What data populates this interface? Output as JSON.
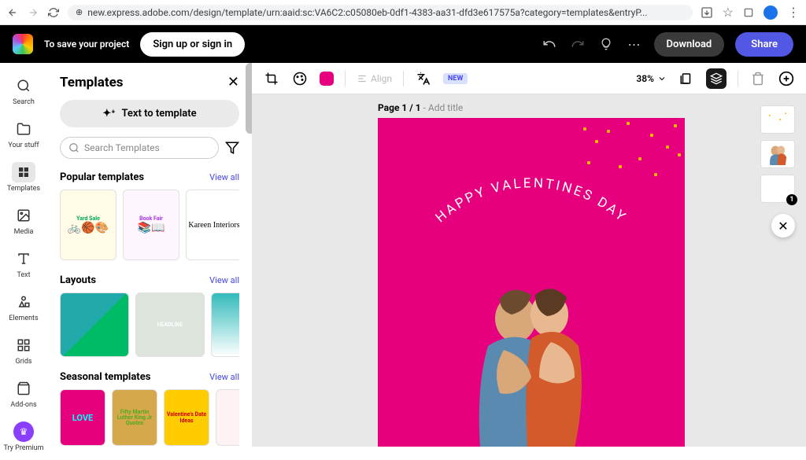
{
  "browser": {
    "url": "new.express.adobe.com/design/template/urn:aaid:sc:VA6C2:c05080eb-0df1-4383-aa31-dfd3e617575a?category=templates&entryP..."
  },
  "header": {
    "save_text": "To save your project",
    "signup_label": "Sign up or sign in",
    "download_label": "Download",
    "share_label": "Share"
  },
  "rail": {
    "search": "Search",
    "your_stuff": "Your stuff",
    "templates": "Templates",
    "media": "Media",
    "text": "Text",
    "elements": "Elements",
    "grids": "Grids",
    "addons": "Add-ons",
    "premium": "Try Premium"
  },
  "panel": {
    "title": "Templates",
    "text_to_template": "Text to template",
    "search_placeholder": "Search Templates",
    "popular": {
      "title": "Popular templates",
      "view_all": "View all",
      "items": [
        "Yard Sale",
        "Book Fair",
        "Kareen Interiors"
      ]
    },
    "layouts": {
      "title": "Layouts",
      "view_all": "View all",
      "items": [
        "",
        "HEADLINE",
        ""
      ]
    },
    "seasonal": {
      "title": "Seasonal templates",
      "view_all": "View all",
      "items": [
        "LOVE",
        "Fifty Martin Luther King Jr Quotes",
        "Valentine's Date Ideas",
        ""
      ]
    }
  },
  "toolbar": {
    "align_label": "Align",
    "new_badge": "NEW",
    "zoom": "38%"
  },
  "canvas": {
    "page_prefix": "Page 1 / 1",
    "page_suffix": " - Add title",
    "valentine_text": "HAPPY VALENTINES DAY"
  },
  "right_thumbs": {
    "badge": "1"
  }
}
